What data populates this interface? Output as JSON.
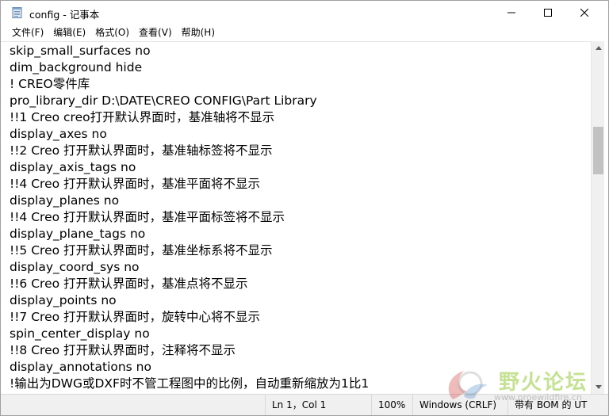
{
  "window": {
    "title": "config - 记事本",
    "controls": {
      "minimize": "—",
      "maximize": "☐",
      "close": "✕"
    }
  },
  "menu": [
    "文件(F)",
    "编辑(E)",
    "格式(O)",
    "查看(V)",
    "帮助(H)"
  ],
  "editor": {
    "lines": [
      "skip_small_surfaces no",
      "dim_background hide",
      "!  CREO零件库",
      "pro_library_dir D:\\DATE\\CREO CONFIG\\Part Library",
      "!!1 Creo creo打开默认界面时，基准轴将不显示",
      "display_axes no",
      "!!2 Creo 打开默认界面时，基准轴标签将不显示",
      "display_axis_tags no",
      "!!4 Creo 打开默认界面时，基准平面将不显示",
      "display_planes no",
      "!!4 Creo 打开默认界面时，基准平面标签将不显示",
      "display_plane_tags no",
      "!!5 Creo 打开默认界面时，基准坐标系将不显示",
      "display_coord_sys no",
      "!!6 Creo 打开默认界面时，基准点将不显示",
      "display_points no",
      "!!7 Creo 打开默认界面时，旋转中心将不显示",
      "spin_center_display no",
      "!!8 Creo 打开默认界面时，注释将不显示",
      "display_annotations no",
      "!输出为DWG或DXF时不管工程图中的比例，自动重新缩放为1比1"
    ]
  },
  "statusbar": {
    "position": "Ln 1，Col 1",
    "zoom": "100%",
    "line_ending": "Windows (CRLF)",
    "encoding": "带有 BOM 的 UT"
  },
  "watermark": {
    "text": "野火论坛",
    "sub": "www.proewildfire.cn"
  },
  "colors": {
    "scroll_thumb": "#c2c2c2",
    "statusbar_bg": "#f0f0f0",
    "watermark_green": "#96c83c"
  }
}
